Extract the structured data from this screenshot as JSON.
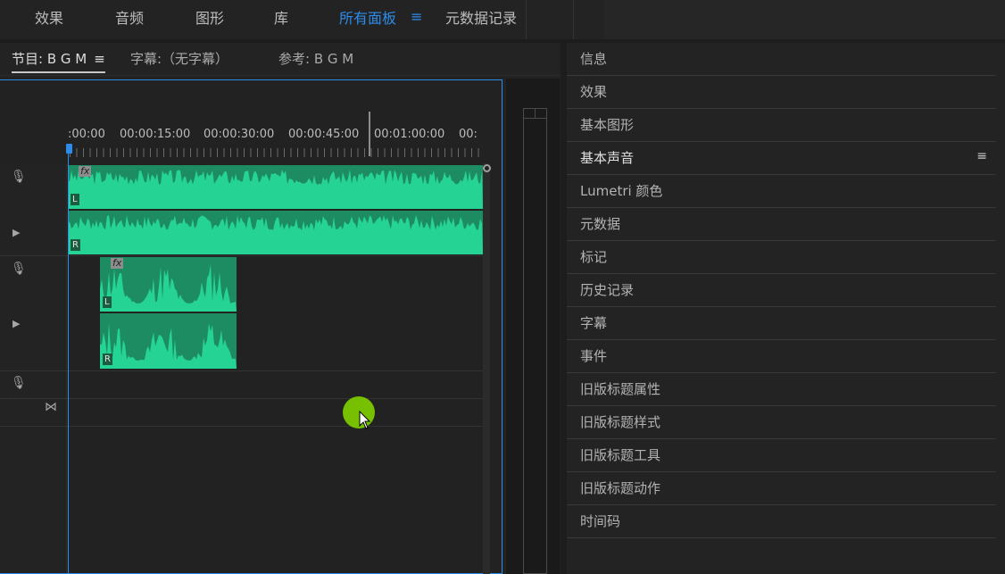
{
  "workspaces": [
    {
      "label": "效果",
      "active": false
    },
    {
      "label": "音频",
      "active": false
    },
    {
      "label": "图形",
      "active": false
    },
    {
      "label": "库",
      "active": false
    },
    {
      "label": "所有面板",
      "active": true
    },
    {
      "label": "元数据记录",
      "active": false
    }
  ],
  "workspace_menu_icon": "hamburger-menu-icon",
  "panel_tabs": [
    {
      "label": "节目: B G M",
      "menu": "≡",
      "active": true
    },
    {
      "label": "字幕:（无字幕）",
      "active": false
    },
    {
      "label": "参考: B G M",
      "active": false
    }
  ],
  "timeline": {
    "ruler_labels": [
      ":00:00",
      "00:00:15:00",
      "00:00:30:00",
      "00:00:45:00",
      "00:01:00:00",
      "00:"
    ],
    "clip_labels": {
      "left": "L",
      "right": "R",
      "fx": "fx"
    },
    "clip_color": "#25d495",
    "playhead_color": "#2d8ceb"
  },
  "panel_list": [
    {
      "label": "信息"
    },
    {
      "label": "效果"
    },
    {
      "label": "基本图形"
    },
    {
      "label": "基本声音",
      "active": true,
      "menu": "≡"
    },
    {
      "label": "Lumetri 颜色"
    },
    {
      "label": "元数据"
    },
    {
      "label": "标记"
    },
    {
      "label": "历史记录"
    },
    {
      "label": "字幕"
    },
    {
      "label": "事件"
    },
    {
      "label": "旧版标题属性"
    },
    {
      "label": "旧版标题样式"
    },
    {
      "label": "旧版标题工具"
    },
    {
      "label": "旧版标题动作"
    },
    {
      "label": "时间码"
    }
  ]
}
